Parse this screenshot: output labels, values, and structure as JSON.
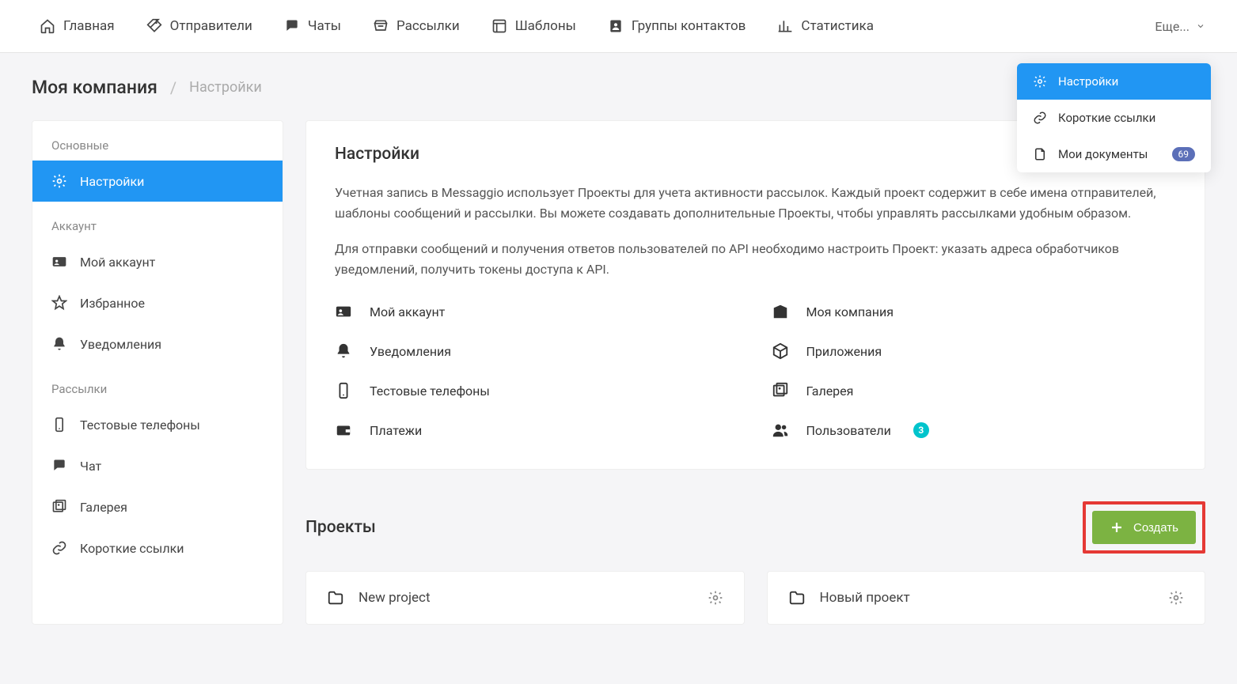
{
  "nav": {
    "items": [
      {
        "icon": "home",
        "label": "Главная"
      },
      {
        "icon": "tag",
        "label": "Отправители"
      },
      {
        "icon": "chat",
        "label": "Чаты"
      },
      {
        "icon": "inbox",
        "label": "Рассылки"
      },
      {
        "icon": "template",
        "label": "Шаблоны"
      },
      {
        "icon": "contacts",
        "label": "Группы контактов"
      },
      {
        "icon": "stats",
        "label": "Статистика"
      }
    ],
    "more": "Еще..."
  },
  "dropdown": {
    "items": [
      {
        "icon": "gear",
        "label": "Настройки",
        "active": true
      },
      {
        "icon": "link",
        "label": "Короткие ссылки"
      },
      {
        "icon": "doc",
        "label": "Мои документы",
        "badge": "69"
      }
    ]
  },
  "breadcrumb": {
    "company": "Моя компания",
    "page": "Настройки"
  },
  "sidebar": {
    "sections": [
      {
        "title": "Основные",
        "items": [
          {
            "icon": "gear",
            "label": "Настройки",
            "active": true
          }
        ]
      },
      {
        "title": "Аккаунт",
        "items": [
          {
            "icon": "idcard",
            "label": "Мой аккаунт"
          },
          {
            "icon": "star",
            "label": "Избранное"
          },
          {
            "icon": "bell",
            "label": "Уведомления"
          }
        ]
      },
      {
        "title": "Рассылки",
        "items": [
          {
            "icon": "phone",
            "label": "Тестовые телефоны"
          },
          {
            "icon": "chat",
            "label": "Чат"
          },
          {
            "icon": "gallery",
            "label": "Галерея"
          },
          {
            "icon": "link",
            "label": "Короткие ссылки"
          }
        ]
      }
    ]
  },
  "settings": {
    "title": "Настройки",
    "para1": "Учетная запись в Messaggio использует Проекты для учета активности рассылок. Каждый проект содержит в себе имена отправителей, шаблоны сообщений и рассылки. Вы можете создавать дополнительные Проекты, чтобы управлять рассылками удобным образом.",
    "para2": "Для отправки сообщений и получения ответов пользователей по API необходимо настроить Проект: указать адреса обработчиков уведомлений, получить токены доступа к API.",
    "links": [
      {
        "icon": "idcard",
        "label": "Мой аккаунт"
      },
      {
        "icon": "company",
        "label": "Моя компания"
      },
      {
        "icon": "bell",
        "label": "Уведомления"
      },
      {
        "icon": "box",
        "label": "Приложения"
      },
      {
        "icon": "phone",
        "label": "Тестовые телефоны"
      },
      {
        "icon": "gallery",
        "label": "Галерея"
      },
      {
        "icon": "wallet",
        "label": "Платежи"
      },
      {
        "icon": "users",
        "label": "Пользователи",
        "badge": "3"
      }
    ]
  },
  "projects": {
    "title": "Проекты",
    "create": "Создать",
    "items": [
      {
        "name": "New project"
      },
      {
        "name": "Новый проект"
      }
    ]
  }
}
